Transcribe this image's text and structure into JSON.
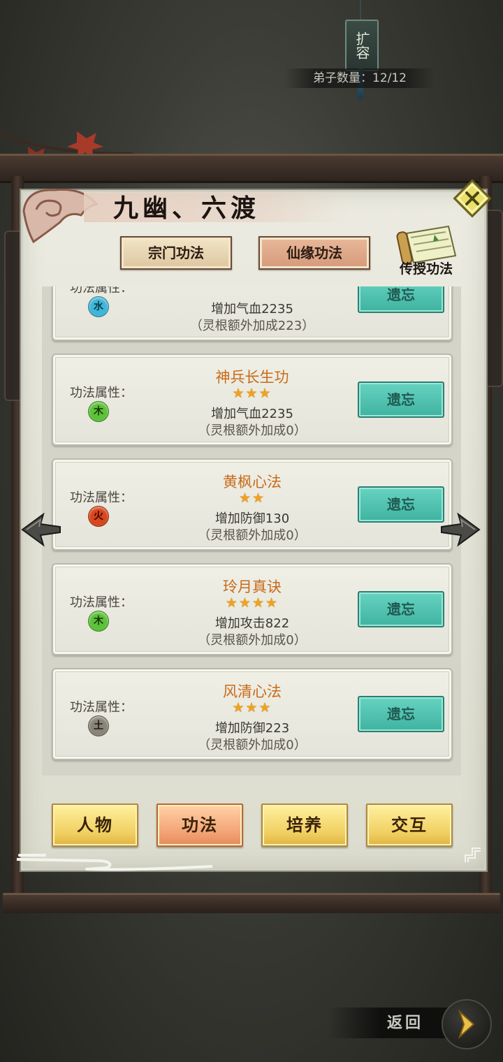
{
  "header": {
    "expand_sign": "扩容",
    "disciple_count_label": "弟子数量：12/12"
  },
  "panel": {
    "title": "九幽、六渡",
    "tabs": [
      {
        "label": "宗门功法",
        "active": false
      },
      {
        "label": "仙缘功法",
        "active": true
      }
    ],
    "teach_label": "传授功法"
  },
  "skills": [
    {
      "attr_label": "功法属性：",
      "element": "水",
      "element_color": "#3fb6d8",
      "name": "",
      "stars": 0,
      "effect": "增加气血2235",
      "bonus": "（灵根额外加成223）",
      "forget_label": "遗忘"
    },
    {
      "attr_label": "功法属性：",
      "element": "木",
      "element_color": "#5cc23a",
      "name": "神兵长生功",
      "stars": 3,
      "stars_text": "★★★",
      "effect": "增加气血2235",
      "bonus": "（灵根额外加成0）",
      "forget_label": "遗忘"
    },
    {
      "attr_label": "功法属性：",
      "element": "火",
      "element_color": "#d8461c",
      "name": "黄枫心法",
      "stars": 2,
      "stars_text": "★★",
      "effect": "增加防御130",
      "bonus": "（灵根额外加成0）",
      "forget_label": "遗忘"
    },
    {
      "attr_label": "功法属性：",
      "element": "木",
      "element_color": "#5cc23a",
      "name": "玲月真诀",
      "stars": 4,
      "stars_text": "★★★★",
      "effect": "增加攻击822",
      "bonus": "（灵根额外加成0）",
      "forget_label": "遗忘"
    },
    {
      "attr_label": "功法属性：",
      "element": "土",
      "element_color": "#8a8478",
      "name": "风清心法",
      "stars": 3,
      "stars_text": "★★★",
      "effect": "增加防御223",
      "bonus": "（灵根额外加成0）",
      "forget_label": "遗忘"
    }
  ],
  "bottom_tabs": [
    {
      "label": "人物",
      "active": false
    },
    {
      "label": "功法",
      "active": true
    },
    {
      "label": "培养",
      "active": false
    },
    {
      "label": "交互",
      "active": false
    }
  ],
  "footer": {
    "back_label": "返回"
  },
  "colors": {
    "forget_button": "#4fc2ae",
    "skill_name": "#c86a18",
    "star": "#f0a21e"
  }
}
